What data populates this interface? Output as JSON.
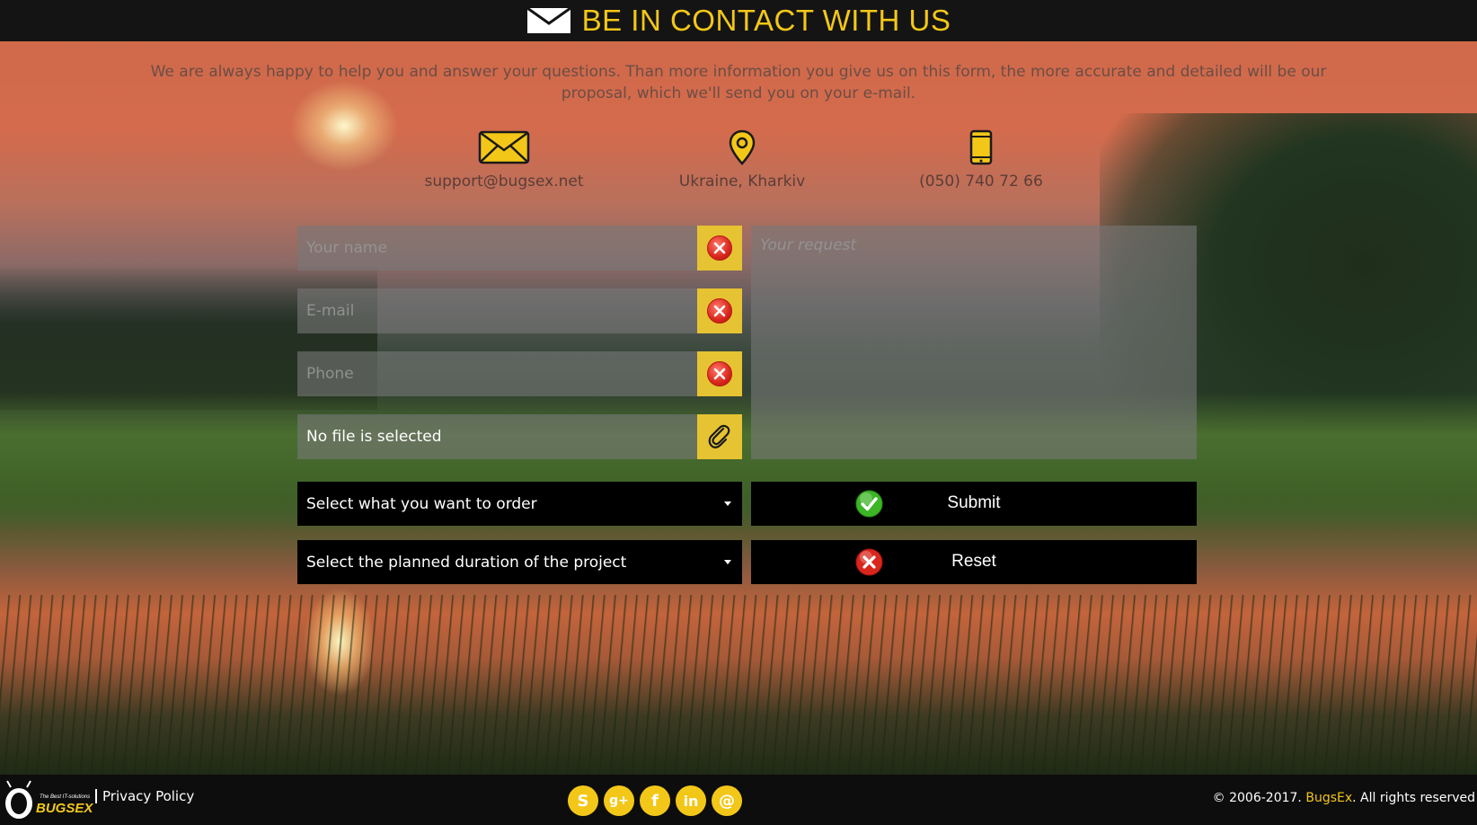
{
  "header": {
    "title": "BE IN CONTACT WITH US",
    "icon": "envelope-icon",
    "accent_color": "#f3c718"
  },
  "intro": "We are always happy to help you and answer your questions. Than more information you give us on this form, the more accurate and detailed will be our proposal, which we'll send you on your e-mail.",
  "contacts": [
    {
      "icon": "envelope-icon",
      "text": "support@bugsex.net"
    },
    {
      "icon": "map-pin-icon",
      "text": "Ukraine, Kharkiv"
    },
    {
      "icon": "mobile-phone-icon",
      "text": "(050) 740 72 66"
    }
  ],
  "form": {
    "name_placeholder": "Your name",
    "email_placeholder": "E-mail",
    "phone_placeholder": "Phone",
    "file_text": "No file is selected",
    "request_placeholder": "Your request",
    "order_select": "Select what you want to order",
    "duration_select": "Select the planned duration of the project",
    "submit_label": "Submit",
    "reset_label": "Reset"
  },
  "footer": {
    "logo_tagline": "The Best IT-solutions",
    "logo_text": "BUGSEX",
    "privacy": "Privacy Policy",
    "socials": [
      {
        "icon": "skype-icon",
        "glyph": "S"
      },
      {
        "icon": "google-plus-icon",
        "glyph": "g+"
      },
      {
        "icon": "facebook-icon",
        "glyph": "f"
      },
      {
        "icon": "linkedin-icon",
        "glyph": "in"
      },
      {
        "icon": "at-email-icon",
        "glyph": "@"
      }
    ],
    "copyright_prefix": "© 2006-2017. ",
    "copyright_brand": "BugsEx",
    "copyright_suffix": ". All rights reserved"
  }
}
